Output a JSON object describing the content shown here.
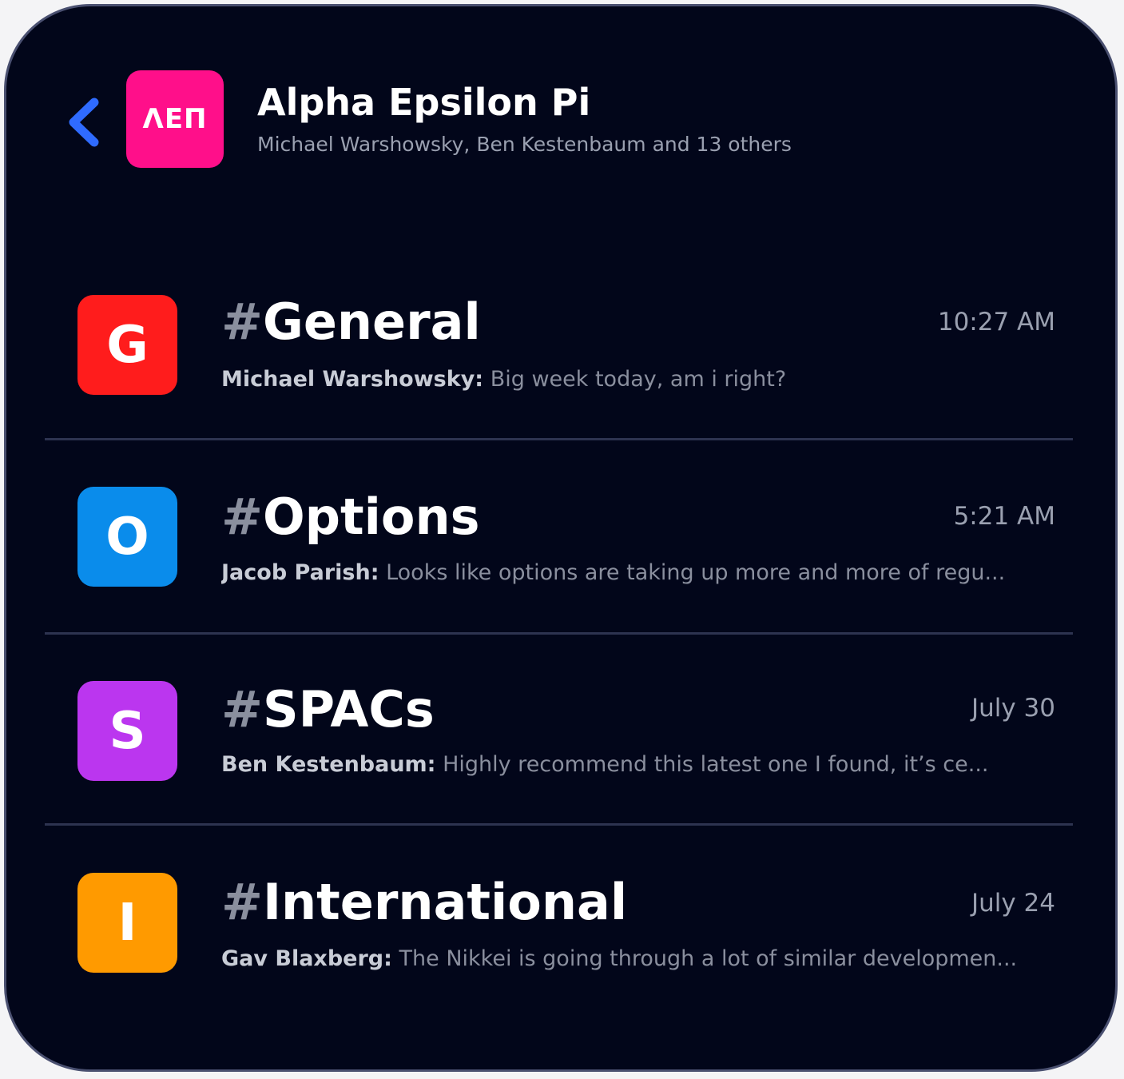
{
  "colors": {
    "background": "#02061a",
    "accent_back": "#2f6bff",
    "group_logo": "#ff0f8a",
    "muted_text": "#8a8f9e",
    "divider": "#2d3350"
  },
  "header": {
    "back_icon": "chevron-left-icon",
    "logo_text": "ΛEΠ",
    "title": "Alpha Epsilon Pi",
    "members": "Michael Warshowsky, Ben Kestenbaum and 13 others"
  },
  "channels": [
    {
      "letter": "G",
      "color": "#ff1c1c",
      "hash": "#",
      "name": "General",
      "time": "10:27 AM",
      "sender": "Michael Warshowsky:",
      "message": " Big week today, am i right?"
    },
    {
      "letter": "O",
      "color": "#0a8ceb",
      "hash": "#",
      "name": "Options",
      "time": "5:21 AM",
      "sender": "Jacob Parish:",
      "message": " Looks like options are taking up more and more of regu..."
    },
    {
      "letter": "S",
      "color": "#bb36ef",
      "hash": "#",
      "name": "SPACs",
      "time": "July 30",
      "sender": "Ben Kestenbaum:",
      "message": " Highly recommend this latest one I found, it’s ce..."
    },
    {
      "letter": "I",
      "color": "#ff9a00",
      "hash": "#",
      "name": "International",
      "time": "July 24",
      "sender": "Gav Blaxberg:",
      "message": " The Nikkei is going through a lot of similar developmen..."
    }
  ]
}
